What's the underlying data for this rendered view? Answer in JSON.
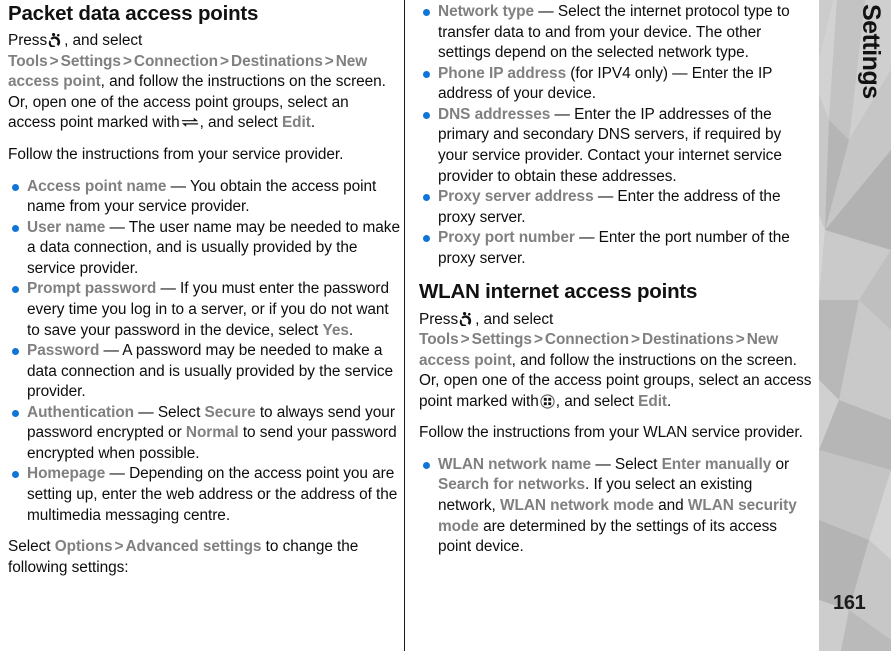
{
  "sidebar": {
    "chapter_label": "Settings",
    "page_number": "161"
  },
  "icons": {
    "menu_key": "menu-key-icon",
    "packet_data": "packet-data-arrows-icon",
    "wlan": "wlan-access-point-icon"
  },
  "colors": {
    "bullet": "#0f75d6",
    "keyword": "#808080",
    "body_text": "#0d0d0d",
    "sidebar_bg": "#b9b9b9"
  },
  "left_column": {
    "title": "Packet data access points",
    "intro": {
      "press_label": "Press",
      "after_icon": ", and select",
      "path": [
        "Tools",
        "Settings",
        "Connection",
        "Destinations",
        "New access point"
      ],
      "separator": ">",
      "tail_1": ", and follow the instructions on the screen. Or, open one of the access point groups, select an access point marked with",
      "tail_2": ", and select",
      "edit_label": "Edit",
      "tail_3": "."
    },
    "follow_line": "Follow the instructions from your service provider.",
    "bullets": [
      {
        "term": "Access point name",
        "desc": "— You obtain the access point name from your service provider."
      },
      {
        "term": "User name",
        "desc": "— The user name may be needed to make a data connection, and is usually provided by the service provider."
      },
      {
        "term": "Prompt password",
        "desc_before": "— If you must enter the password every time you log in to a server, or if you do not want to save your password in the device, select ",
        "inline_kw": "Yes",
        "desc_after": "."
      },
      {
        "term": "Password",
        "desc": "— A password may be needed to make a data connection and is usually provided by the service provider."
      },
      {
        "term": "Authentication",
        "desc_before": "— Select ",
        "inline_kw": "Secure",
        "desc_mid": " to always send your password encrypted or ",
        "inline_kw2": "Normal",
        "desc_after": " to send your password encrypted when possible."
      },
      {
        "term": "Homepage",
        "desc": "— Depending on the access point you are setting up, enter the web address or the address of the multimedia messaging centre."
      }
    ],
    "closing": {
      "prefix": "Select ",
      "kw1": "Options",
      "sep": ">",
      "kw2": "Advanced settings",
      "suffix": " to change the following settings:"
    }
  },
  "right_column": {
    "bullets_top": [
      {
        "term": "Network type",
        "desc": "— Select the internet protocol type to transfer data to and from your device. The other settings depend on the selected network type."
      },
      {
        "term": "Phone IP address",
        "term_suffix": " (for IPV4 only)",
        "desc": "— Enter the IP address of your device."
      },
      {
        "term": "DNS addresses",
        "desc": "— Enter the IP addresses of the primary and secondary DNS servers, if required by your service provider. Contact your internet service provider to obtain these addresses."
      },
      {
        "term": "Proxy server address",
        "desc": "— Enter the address of the proxy server."
      },
      {
        "term": "Proxy port number",
        "desc": "— Enter the port number of the proxy server."
      }
    ],
    "title": "WLAN internet access points",
    "intro": {
      "press_label": "Press",
      "after_icon": ", and select",
      "path": [
        "Tools",
        "Settings",
        "Connection",
        "Destinations",
        "New access point"
      ],
      "separator": ">",
      "tail_1": ", and follow the instructions on the screen. Or, open one of the access point groups, select an access point marked with",
      "tail_2": ", and select",
      "edit_label": "Edit",
      "tail_3": "."
    },
    "follow_line": "Follow the instructions from your WLAN service provider.",
    "bullets_bottom": [
      {
        "term": "WLAN network name",
        "desc_before": "— Select ",
        "kw1": "Enter manually",
        "desc_mid1": " or ",
        "kw2": "Search for networks",
        "desc_mid2": ". If you select an existing network, ",
        "kw3": "WLAN network mode",
        "desc_mid3": " and ",
        "kw4": "WLAN security mode",
        "desc_after": " are determined by the settings of its access point device."
      }
    ]
  }
}
